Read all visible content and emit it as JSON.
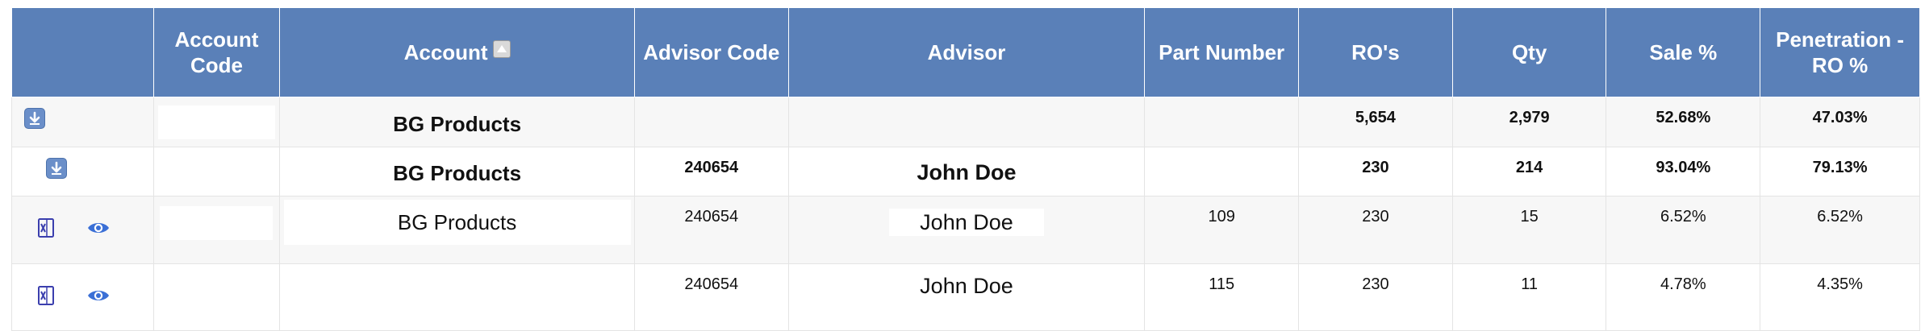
{
  "headers": [
    {
      "key": "actions",
      "label": ""
    },
    {
      "key": "account_code",
      "label": "Account Code"
    },
    {
      "key": "account",
      "label": "Account"
    },
    {
      "key": "advisor_code",
      "label": "Advisor Code"
    },
    {
      "key": "advisor",
      "label": "Advisor"
    },
    {
      "key": "part_number",
      "label": "Part Number"
    },
    {
      "key": "ros",
      "label": "RO's"
    },
    {
      "key": "qty",
      "label": "Qty"
    },
    {
      "key": "sale_pct",
      "label": "Sale %"
    },
    {
      "key": "penetration",
      "label": "Penetration - RO %"
    }
  ],
  "sort": {
    "column": "account",
    "direction": "ascending",
    "icon": "sort-up-icon"
  },
  "rows": [
    {
      "level": "group",
      "account_code": "",
      "account": "BG Products",
      "advisor_code": "",
      "advisor": "",
      "part_number": "",
      "ros": "5,654",
      "qty": "2,979",
      "sale_pct": "52.68%",
      "penetration": "47.03%"
    },
    {
      "level": "subgroup",
      "account_code": "",
      "account": "BG Products",
      "advisor_code": "240654",
      "advisor": "John Doe",
      "part_number": "",
      "ros": "230",
      "qty": "214",
      "sale_pct": "93.04%",
      "penetration": "79.13%"
    },
    {
      "level": "detail",
      "account_code": "",
      "account": "BG Products",
      "advisor_code": "240654",
      "advisor": "John Doe",
      "part_number": "109",
      "ros": "230",
      "qty": "15",
      "sale_pct": "6.52%",
      "penetration": "6.52%"
    },
    {
      "level": "detail",
      "account_code": "",
      "account": "",
      "advisor_code": "240654",
      "advisor": "John Doe",
      "part_number": "115",
      "ros": "230",
      "qty": "11",
      "sale_pct": "4.78%",
      "penetration": "4.35%"
    }
  ],
  "colors": {
    "header_bg": "#5a80b8",
    "expand_icon": "#6b8fc9",
    "view_icon": "#3a6fd6",
    "excel_icon": "#3b3fae"
  }
}
